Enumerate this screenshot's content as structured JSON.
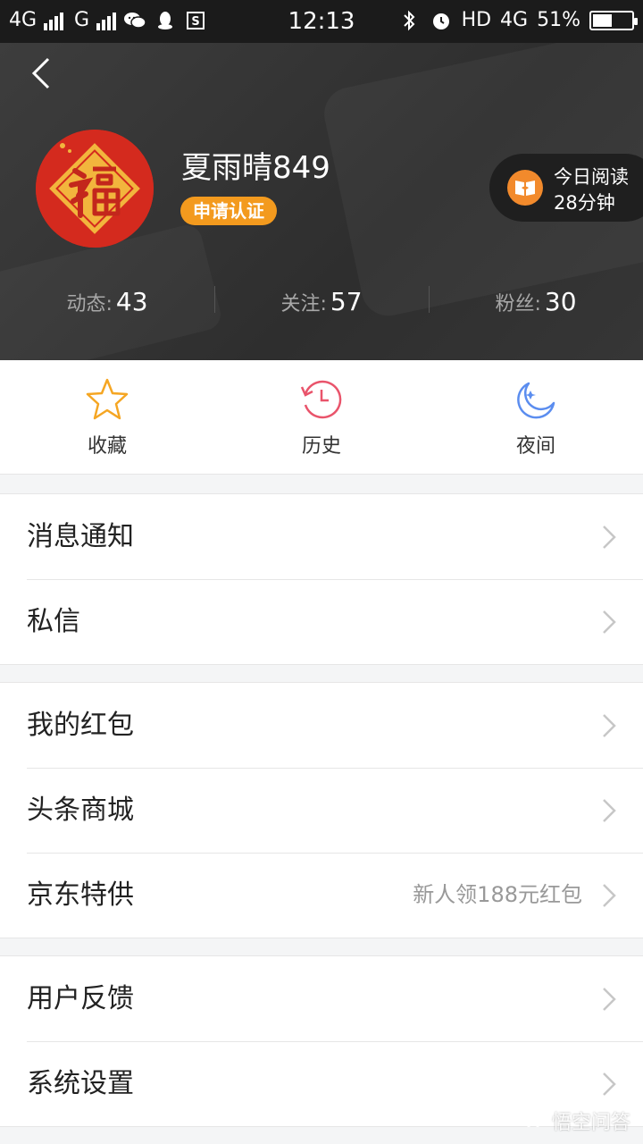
{
  "status_bar": {
    "network1": "4G",
    "network2": "G",
    "time": "12:13",
    "hd": "HD",
    "network3": "4G",
    "battery": "51%",
    "battery_level": 0.51
  },
  "profile": {
    "username": "夏雨晴849",
    "verify_label": "申请认证",
    "reading_line1": "今日阅读",
    "reading_line2": "28分钟",
    "stats": [
      {
        "label": "动态:",
        "value": "43"
      },
      {
        "label": "关注:",
        "value": "57"
      },
      {
        "label": "粉丝:",
        "value": "30"
      }
    ]
  },
  "quick_actions": [
    {
      "label": "收藏",
      "icon": "star-icon"
    },
    {
      "label": "历史",
      "icon": "history-clock-icon"
    },
    {
      "label": "夜间",
      "icon": "moon-icon"
    }
  ],
  "menu": {
    "group1": [
      {
        "label": "消息通知"
      },
      {
        "label": "私信"
      }
    ],
    "group2": [
      {
        "label": "我的红包"
      },
      {
        "label": "头条商城"
      },
      {
        "label": "京东特供",
        "sub": "新人领188元红包"
      }
    ],
    "group3": [
      {
        "label": "用户反馈"
      },
      {
        "label": "系统设置"
      }
    ]
  },
  "watermark": "悟空问答",
  "colors": {
    "header_bg": "#363636",
    "verify_orange": "#f39a1e",
    "star_orange": "#f5a623",
    "history_pink": "#e9546b",
    "moon_blue": "#5b8def"
  }
}
